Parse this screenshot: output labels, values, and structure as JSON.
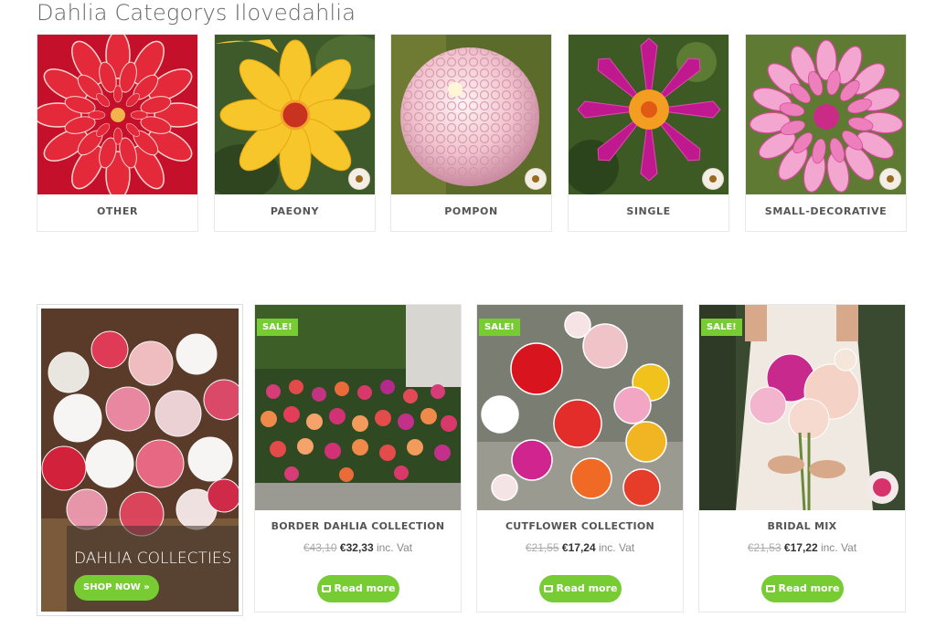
{
  "section": {
    "title": "Dahlia Categorys Ilovedahlia"
  },
  "categories": [
    {
      "label": "OTHER",
      "image": "red-dahlia-photo"
    },
    {
      "label": "PAEONY",
      "image": "yellow-dahlia-photo"
    },
    {
      "label": "POMPON",
      "image": "pink-pompon-dahlia-photo"
    },
    {
      "label": "SINGLE",
      "image": "magenta-single-dahlia-photo"
    },
    {
      "label": "SMALL-DECORATIVE",
      "image": "pink-decorative-dahlia-photo"
    }
  ],
  "promo": {
    "title": "DAHLIA COLLECTIES",
    "button": "SHOP NOW »",
    "image": "dahlia-bouquet-photo"
  },
  "products": [
    {
      "badge": "SALE!",
      "title": "BORDER DAHLIA COLLECTION",
      "old_price": "€43,10",
      "price": "€32,33",
      "vat": "inc. Vat",
      "button": "Read more",
      "image": "border-dahlia-garden-photo"
    },
    {
      "badge": "SALE!",
      "title": "CUTFLOWER COLLECTION",
      "old_price": "€21,55",
      "price": "€17,24",
      "vat": "inc. Vat",
      "button": "Read more",
      "image": "cutflower-dahlias-photo"
    },
    {
      "badge": "SALE!",
      "title": "BRIDAL MIX",
      "old_price": "€21,53",
      "price": "€17,22",
      "vat": "inc. Vat",
      "button": "Read more",
      "image": "bridal-bouquet-photo"
    }
  ],
  "colors": {
    "accent": "#77cc33",
    "text": "#555555"
  }
}
